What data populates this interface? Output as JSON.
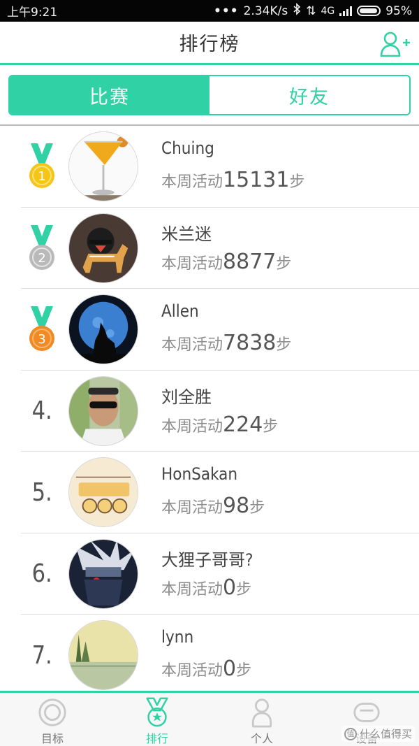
{
  "status_bar": {
    "time": "上午9:21",
    "dots": "•••",
    "net_speed": "2.34K/s",
    "bluetooth": "bluetooth-icon",
    "data_arrows": "⇅",
    "network_type": "4G",
    "battery_level": 0.95,
    "battery_text": "95%"
  },
  "header": {
    "title": "排行榜",
    "add_friend_icon": "add-user-icon"
  },
  "tabs": [
    {
      "label": "比赛",
      "active": true
    },
    {
      "label": "好友",
      "active": false
    }
  ],
  "ranking": {
    "steps_prefix": "本周活动",
    "steps_suffix": "步",
    "medal_colors": {
      "gold": "#f5c518",
      "silver": "#b9b9b9",
      "bronze": "#f08a24",
      "ribbon": "#2fd1a5"
    },
    "items": [
      {
        "rank_text": "1",
        "medal": "gold",
        "name": "Chuing",
        "steps": "15131",
        "avatar": "cocktail-glass-avatar"
      },
      {
        "rank_text": "2",
        "medal": "silver",
        "name": "米兰迷",
        "steps": "8877",
        "avatar": "cartoon-horse-avatar"
      },
      {
        "rank_text": "3",
        "medal": "bronze",
        "name": "Allen",
        "steps": "7838",
        "avatar": "wolf-moon-avatar"
      },
      {
        "rank_text": "4.",
        "medal": null,
        "name": "刘全胜",
        "steps": "224",
        "avatar": "man-sunglasses-avatar"
      },
      {
        "rank_text": "5.",
        "medal": null,
        "name": "HonSakan",
        "steps": "98",
        "avatar": "sushi-sketch-avatar"
      },
      {
        "rank_text": "6.",
        "medal": null,
        "name": "大狸子哥哥?",
        "steps": "0",
        "avatar": "anime-ninja-avatar"
      },
      {
        "rank_text": "7.",
        "medal": null,
        "name": "lynn",
        "steps": "0",
        "avatar": "landscape-painting-avatar"
      }
    ]
  },
  "bottom_nav": [
    {
      "label": "目标",
      "icon": "target-icon",
      "active": false
    },
    {
      "label": "排行",
      "icon": "medal-icon",
      "active": true
    },
    {
      "label": "个人",
      "icon": "person-icon",
      "active": false
    },
    {
      "label": "设备",
      "icon": "band-icon",
      "active": false
    }
  ],
  "watermark": {
    "text": "什么值得买",
    "logo": "值"
  },
  "colors": {
    "accent": "#2fd1a5",
    "text_dark": "#333333",
    "text_gray": "#8c8c8c"
  }
}
